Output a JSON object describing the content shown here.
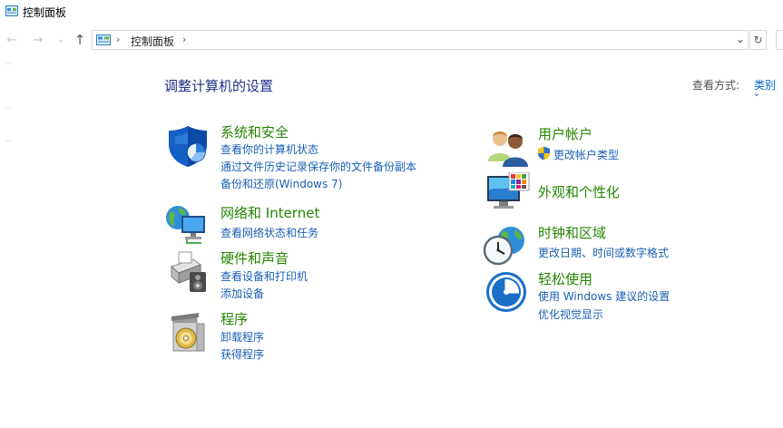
{
  "window": {
    "title": "控制面板"
  },
  "nav": {
    "back": "←",
    "forward": "→",
    "recent": "⌄",
    "up": "↑"
  },
  "address": {
    "separator": "›",
    "crumb": "控制面板",
    "dropdown": "⌄",
    "refresh": "↻"
  },
  "main": {
    "heading": "调整计算机的设置",
    "viewby_label": "查看方式:",
    "viewby_value": "类别 ˅"
  },
  "categories_left": [
    {
      "title": "系统和安全",
      "icon": "shield-icon",
      "links": [
        "查看你的计算机状态",
        "通过文件历史记录保存你的文件备份副本",
        "备份和还原(Windows 7)"
      ]
    },
    {
      "title": "网络和 Internet",
      "icon": "network-globe-icon",
      "links": [
        "查看网络状态和任务"
      ]
    },
    {
      "title": "硬件和声音",
      "icon": "printer-speaker-icon",
      "links": [
        "查看设备和打印机",
        "添加设备"
      ]
    },
    {
      "title": "程序",
      "icon": "programs-disc-icon",
      "links": [
        "卸载程序",
        "获得程序"
      ]
    }
  ],
  "categories_right": [
    {
      "title": "用户帐户",
      "icon": "users-icon",
      "links": [
        "更改帐户类型"
      ]
    },
    {
      "title": "外观和个性化",
      "icon": "monitor-palette-icon",
      "links": []
    },
    {
      "title": "时钟和区域",
      "icon": "clock-globe-icon",
      "links": [
        "更改日期、时间或数字格式"
      ]
    },
    {
      "title": "轻松使用",
      "icon": "ease-of-access-icon",
      "links": [
        "使用 Windows 建议的设置",
        "优化视觉显示"
      ]
    }
  ],
  "colors": {
    "heading": "#1e3287",
    "category_title": "#248500",
    "link": "#1a5fb4"
  }
}
